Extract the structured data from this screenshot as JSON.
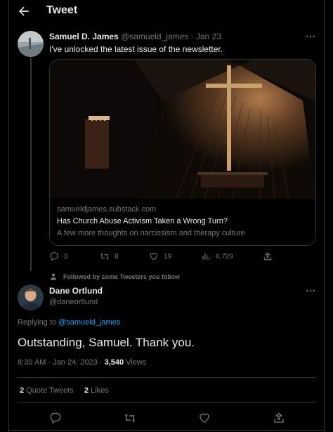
{
  "header": {
    "title": "Tweet"
  },
  "parent_tweet": {
    "display_name": "Samuel D. James",
    "handle": "@samueld_james",
    "separator": "·",
    "date": "Jan 23",
    "text": "I've unlocked the latest issue of the newsletter.",
    "card": {
      "domain": "samueldjames.substack.com",
      "title": "Has Church Abuse Activism Taken a Wrong Turn?",
      "description": "A few more thoughts on narcissism and therapy culture"
    },
    "stats": {
      "replies": "3",
      "retweets": "8",
      "likes": "19",
      "views": "8,729"
    }
  },
  "social_context": "Followed by some Tweeters you follow",
  "main_tweet": {
    "display_name": "Dane Ortlund",
    "handle": "@daneortlund",
    "replying_to_label": "Replying to",
    "replying_to_handle": "@samueld_james",
    "text": "Outstanding, Samuel. Thank you.",
    "time": "8:30 AM",
    "date": "Jan 24, 2023",
    "separator": "·",
    "views_count": "3,540",
    "views_label": "Views",
    "quote_count": "2",
    "quote_label": "Quote Tweets",
    "likes_count": "2",
    "likes_label": "Likes"
  },
  "colors": {
    "background": "#000000",
    "text": "#e7e9ea",
    "muted": "#71767b",
    "link": "#1d9bf0",
    "border": "#2f3336"
  },
  "icons": [
    "back-arrow-icon",
    "more-icon",
    "reply-icon",
    "retweet-icon",
    "like-icon",
    "views-icon",
    "share-icon",
    "person-icon"
  ]
}
